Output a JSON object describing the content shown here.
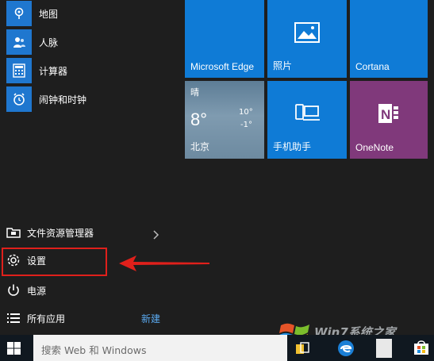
{
  "apps": [
    {
      "label": "地图",
      "icon": "map-icon"
    },
    {
      "label": "人脉",
      "icon": "people-icon"
    },
    {
      "label": "计算器",
      "icon": "calculator-icon"
    },
    {
      "label": "闹钟和时钟",
      "icon": "alarm-clock-icon"
    }
  ],
  "tiles": {
    "edge": "Microsoft Edge",
    "photos": "照片",
    "cortana": "Cortana",
    "weather": {
      "condition": "晴",
      "temp": "8°",
      "high": "10°",
      "low": "-1°",
      "city": "北京"
    },
    "phone": "手机助手",
    "onenote": "OneNote"
  },
  "system": {
    "explorer": "文件资源管理器",
    "settings": "设置",
    "power": "电源",
    "all_apps": "所有应用",
    "new_badge": "新建"
  },
  "taskbar": {
    "search_placeholder": "搜索 Web 和 Windows"
  },
  "watermark": "Win7系统之家",
  "colors": {
    "tile_blue": "#0f7bd6",
    "onenote_purple": "#80397b",
    "highlight_red": "#e0201b",
    "new_badge": "#5aa9ef"
  }
}
